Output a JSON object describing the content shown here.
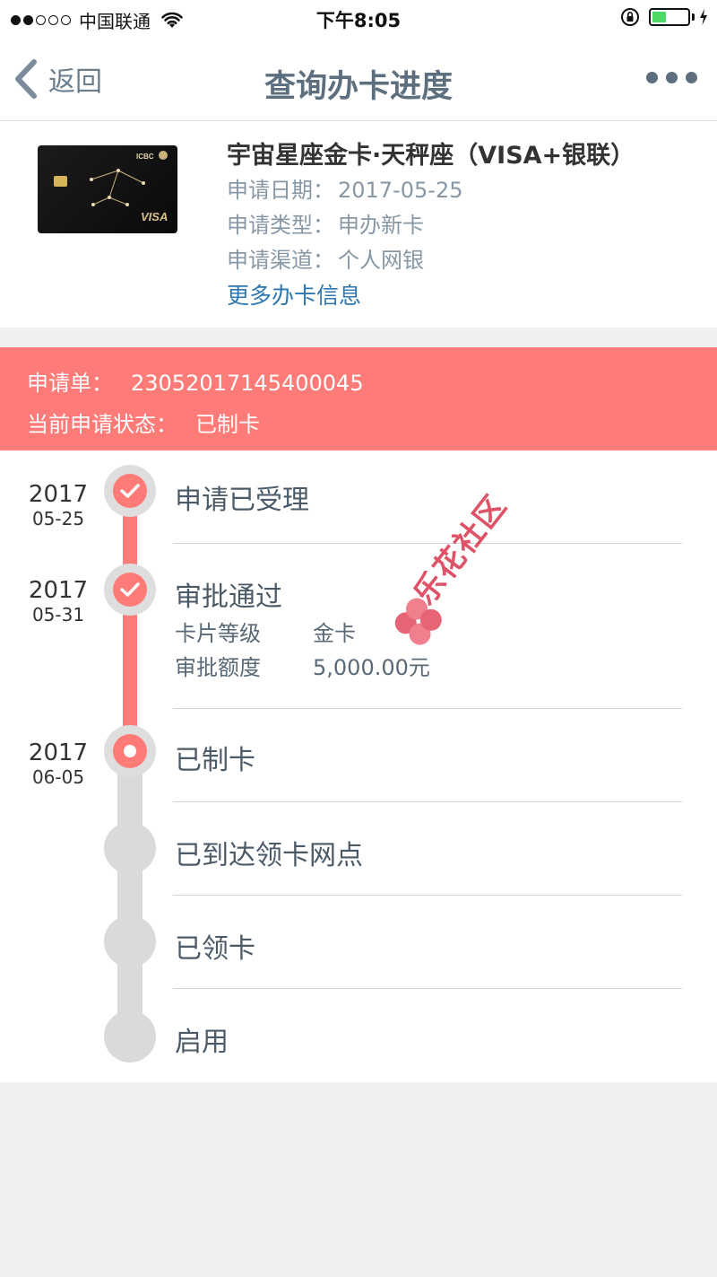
{
  "status_bar": {
    "carrier": "中国联通",
    "time": "下午8:05",
    "battery_percent": 40,
    "signal_bars_filled": 2,
    "signal_bars_total": 5
  },
  "nav": {
    "back_label": "返回",
    "title": "查询办卡进度",
    "more_icon": "more-dots-icon"
  },
  "card": {
    "name": "宇宙星座金卡·天秤座（VISA+银联）",
    "apply_date_label": "申请日期：",
    "apply_date": "2017-05-25",
    "apply_type_label": "申请类型：",
    "apply_type": "申办新卡",
    "apply_channel_label": "申请渠道：",
    "apply_channel": "个人网银",
    "more_link": "更多办卡信息",
    "card_brand_text": "ICBC",
    "card_network_text": "VISA"
  },
  "banner": {
    "order_label": "申请单：",
    "order_no": "23052017145400045",
    "status_label": "当前申请状态：",
    "status_value": "已制卡",
    "color": "#ff7b78"
  },
  "timeline": [
    {
      "year": "2017",
      "md": "05-25",
      "label": "申请已受理",
      "state": "done"
    },
    {
      "year": "2017",
      "md": "05-31",
      "label": "审批通过",
      "state": "done",
      "details": [
        {
          "key": "卡片等级",
          "value": "金卡"
        },
        {
          "key": "审批额度",
          "value": "5,000.00元"
        }
      ]
    },
    {
      "year": "2017",
      "md": "06-05",
      "label": "已制卡",
      "state": "current"
    },
    {
      "year": "",
      "md": "",
      "label": "已到达领卡网点",
      "state": "pending"
    },
    {
      "year": "",
      "md": "",
      "label": "已领卡",
      "state": "pending"
    },
    {
      "year": "",
      "md": "",
      "label": "启用",
      "state": "pending"
    }
  ],
  "watermark": {
    "text": "乐花社区"
  },
  "colors": {
    "accent": "#ff7b78",
    "link": "#2f77b1",
    "nav_text": "#5d6f7f",
    "muted": "#8797a6"
  }
}
